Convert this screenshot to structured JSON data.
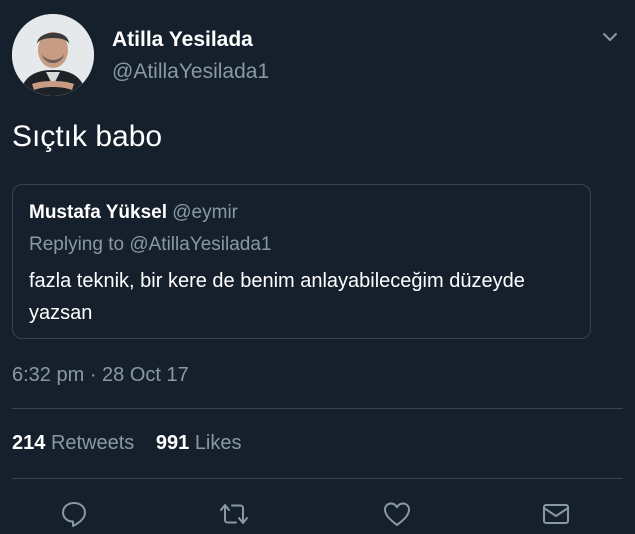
{
  "author": {
    "display_name": "Atilla Yesilada",
    "handle": "@AtillaYesilada1"
  },
  "tweet": {
    "text": "Sıçtık babo",
    "timestamp": "6:32 pm · 28 Oct 17"
  },
  "quoted": {
    "display_name": "Mustafa Yüksel",
    "handle": "@eymir",
    "replying_to": "Replying to @AtillaYesilada1",
    "text": "fazla teknik, bir kere de benim anlayabileceğim düzeyde yazsan"
  },
  "stats": {
    "retweets_count": "214",
    "retweets_label": "Retweets",
    "likes_count": "991",
    "likes_label": "Likes"
  },
  "actions": [
    "reply-icon",
    "retweet-icon",
    "like-icon",
    "message-icon"
  ],
  "colors": {
    "background": "#16202c",
    "secondary_text": "#8899a6",
    "border": "#38444d"
  }
}
